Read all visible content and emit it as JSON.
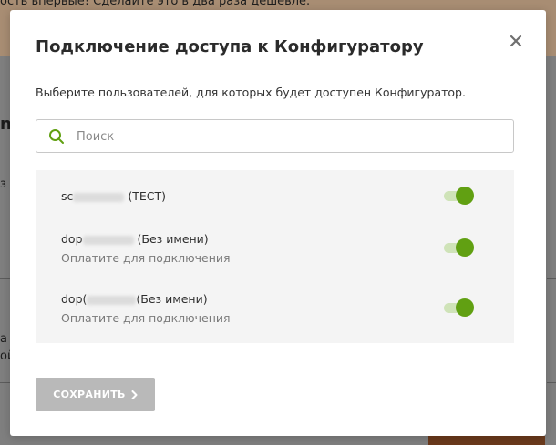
{
  "background": {
    "banner_text": "ость впервые! Сделайте это в два раза дешевле.",
    "letters": [
      "n",
      "з 1",
      "а",
      "ой"
    ]
  },
  "modal": {
    "title": "Подключение доступа к Конфигуратору",
    "description": "Выберите пользователей, для которых будет доступен Конфигуратор.",
    "close_icon": "close-icon",
    "search": {
      "placeholder": "Поиск",
      "value": ""
    },
    "users": [
      {
        "name_prefix": "sc",
        "name_suffix": " (ТЕСТ)",
        "subtitle": "",
        "enabled": true
      },
      {
        "name_prefix": "dop",
        "name_suffix": " (Без имени)",
        "subtitle": "Оплатите для подключения",
        "enabled": true
      },
      {
        "name_prefix": "dop(",
        "name_suffix": "(Без имени)",
        "subtitle": "Оплатите для подключения",
        "enabled": true
      }
    ],
    "save_label": "СОХРАНИТЬ"
  },
  "colors": {
    "accent_green": "#61a012",
    "toggle_track": "#cfe3b8",
    "save_disabled": "#b9b9b9"
  }
}
